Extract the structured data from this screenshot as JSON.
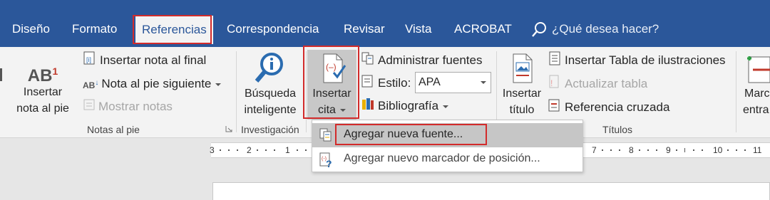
{
  "tabs": [
    {
      "label": "Diseño",
      "active": false
    },
    {
      "label": "Formato",
      "active": false
    },
    {
      "label": "Referencias",
      "active": true
    },
    {
      "label": "Correspondencia",
      "active": false
    },
    {
      "label": "Revisar",
      "active": false
    },
    {
      "label": "Vista",
      "active": false
    },
    {
      "label": "ACROBAT",
      "active": false
    }
  ],
  "tell_me": {
    "icon": "lightbulb-icon",
    "text": "¿Qué desea hacer?"
  },
  "groups": {
    "footnotes": {
      "label": "Notas al pie",
      "insert_footnote": {
        "line1": "Insertar",
        "line2": "nota al pie",
        "badge": "AB",
        "sup": "1"
      },
      "insert_endnote": "Insertar nota al final",
      "next_footnote": "Nota al pie siguiente",
      "show_notes": "Mostrar notas"
    },
    "research": {
      "label": "Investigación",
      "smart_lookup": {
        "line1": "Búsqueda",
        "line2": "inteligente"
      }
    },
    "citations": {
      "insert_citation": {
        "line1": "Insertar",
        "line2": "cita"
      },
      "manage_sources": "Administrar fuentes",
      "style_label": "Estilo:",
      "style_value": "APA",
      "bibliography": "Bibliografía"
    },
    "captions": {
      "label": "Títulos",
      "insert_caption": {
        "line1": "Insertar",
        "line2": "título"
      },
      "insert_table_figures": "Insertar Tabla de ilustraciones",
      "update_table": "Actualizar tabla",
      "cross_reference": "Referencia cruzada"
    },
    "index": {
      "mark_entry": {
        "line1": "Marc",
        "line2": "entra"
      }
    }
  },
  "menu": {
    "items": [
      {
        "label": "Agregar nueva fuente...",
        "highlighted": true
      },
      {
        "label": "Agregar nuevo marcador de posición...",
        "highlighted": false
      }
    ]
  },
  "ruler": {
    "numbers": [
      "3",
      "2",
      "1",
      "1",
      "7",
      "8",
      "9",
      "10",
      "11"
    ]
  },
  "colors": {
    "tab_bar": "#2b579a",
    "ribbon": "#f3f3f3",
    "highlight_box": "#d22b2b",
    "accent_red": "#c0392b",
    "accent_blue": "#2b6cb0"
  }
}
